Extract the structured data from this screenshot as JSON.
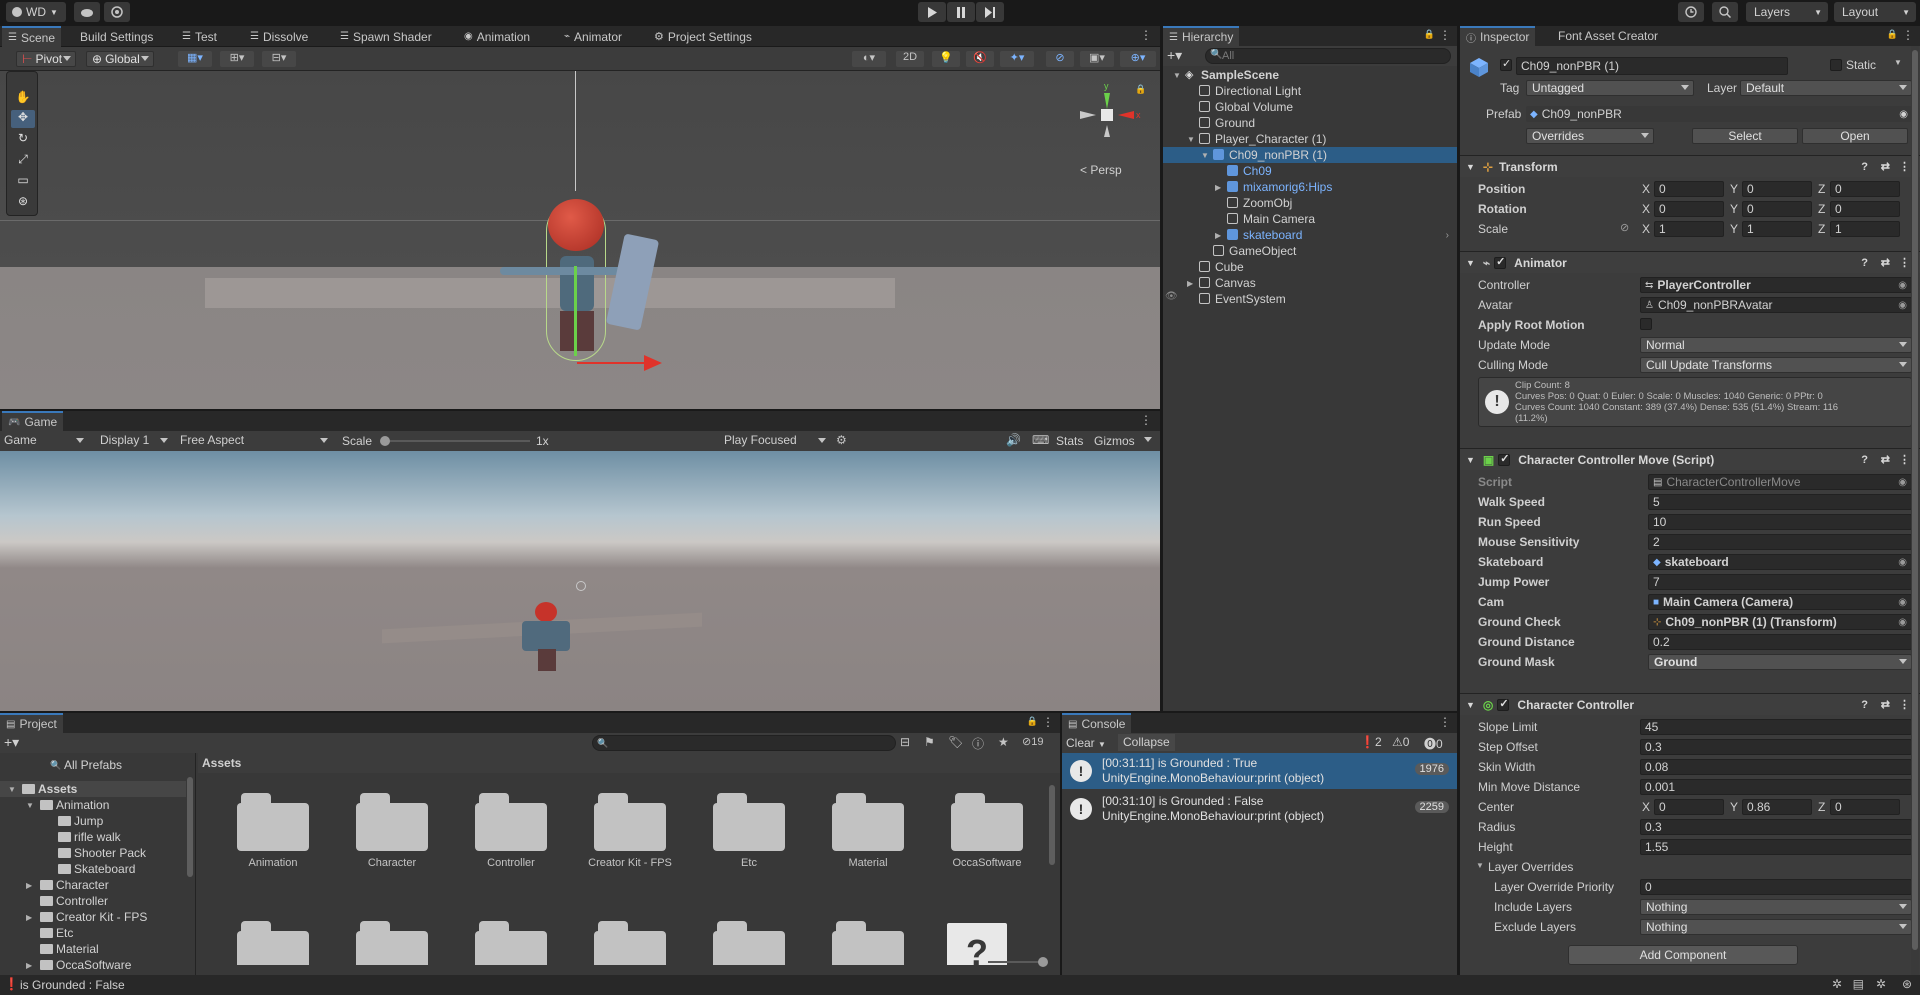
{
  "topbar": {
    "account": "WD",
    "layers": "Layers",
    "layout": "Layout"
  },
  "scene_tabs": [
    "Scene",
    "Build Settings",
    "Test",
    "Dissolve",
    "Spawn Shader",
    "Animation",
    "Animator",
    "Project Settings"
  ],
  "scene_toolbar": {
    "pivot": "Pivot",
    "global": "Global",
    "mode2d": "2D",
    "persp": "< Persp"
  },
  "game": {
    "tab": "Game",
    "display_mode": "Game",
    "display": "Display 1",
    "aspect": "Free Aspect",
    "scale_label": "Scale",
    "scale_value": "1x",
    "play_focused": "Play Focused",
    "stats": "Stats",
    "gizmos": "Gizmos"
  },
  "hierarchy": {
    "tab": "Hierarchy",
    "search_placeholder": "All",
    "items": [
      {
        "label": "SampleScene",
        "indent": 0,
        "kind": "scene",
        "arrow": "open"
      },
      {
        "label": "Directional Light",
        "indent": 1,
        "kind": "go"
      },
      {
        "label": "Global Volume",
        "indent": 1,
        "kind": "go"
      },
      {
        "label": "Ground",
        "indent": 1,
        "kind": "go"
      },
      {
        "label": "Player_Character (1)",
        "indent": 1,
        "kind": "go",
        "arrow": "open"
      },
      {
        "label": "Ch09_nonPBR (1)",
        "indent": 2,
        "kind": "prefab",
        "arrow": "open",
        "selected": true
      },
      {
        "label": "Ch09",
        "indent": 3,
        "kind": "prefab",
        "blue": true
      },
      {
        "label": "mixamorig6:Hips",
        "indent": 3,
        "kind": "prefab",
        "blue": true,
        "arrow": "closed"
      },
      {
        "label": "ZoomObj",
        "indent": 3,
        "kind": "go"
      },
      {
        "label": "Main Camera",
        "indent": 3,
        "kind": "go"
      },
      {
        "label": "skateboard",
        "indent": 3,
        "kind": "prefab",
        "blue": true,
        "arrow": "closed"
      },
      {
        "label": "GameObject",
        "indent": 2,
        "kind": "go"
      },
      {
        "label": "Cube",
        "indent": 1,
        "kind": "go"
      },
      {
        "label": "Canvas",
        "indent": 1,
        "kind": "go",
        "arrow": "closed"
      },
      {
        "label": "EventSystem",
        "indent": 1,
        "kind": "go"
      }
    ]
  },
  "inspector": {
    "tabs": [
      "Inspector",
      "Font Asset Creator"
    ],
    "object_name": "Ch09_nonPBR (1)",
    "static": "Static",
    "tag_label": "Tag",
    "tag": "Untagged",
    "layer_label": "Layer",
    "layer": "Default",
    "prefab_label": "Prefab",
    "prefab": "Ch09_nonPBR",
    "overrides": "Overrides",
    "select": "Select",
    "open": "Open",
    "transform": {
      "title": "Transform",
      "position_label": "Position",
      "position": [
        "0",
        "0",
        "0"
      ],
      "rotation_label": "Rotation",
      "rotation": [
        "0",
        "0",
        "0"
      ],
      "scale_label": "Scale",
      "scale": [
        "1",
        "1",
        "1"
      ]
    },
    "animator": {
      "title": "Animator",
      "controller_label": "Controller",
      "controller": "PlayerController",
      "avatar_label": "Avatar",
      "avatar": "Ch09_nonPBRAvatar",
      "root_motion_label": "Apply Root Motion",
      "update_mode_label": "Update Mode",
      "update_mode": "Normal",
      "culling_label": "Culling Mode",
      "culling": "Cull Update Transforms",
      "info_lines": [
        "Clip Count: 8",
        "Curves Pos: 0 Quat: 0 Euler: 0 Scale: 0 Muscles: 1040 Generic: 0 PPtr: 0",
        "Curves Count: 1040 Constant: 389 (37.4%) Dense: 535 (51.4%) Stream: 116",
        "(11.2%)"
      ]
    },
    "ccm": {
      "title": "Character Controller Move (Script)",
      "script_label": "Script",
      "script": "CharacterControllerMove",
      "walk_label": "Walk Speed",
      "walk": "5",
      "run_label": "Run Speed",
      "run": "10",
      "mouse_label": "Mouse Sensitivity",
      "mouse": "2",
      "skate_label": "Skateboard",
      "skate": "skateboard",
      "jump_label": "Jump Power",
      "jump": "7",
      "cam_label": "Cam",
      "cam": "Main Camera (Camera)",
      "gcheck_label": "Ground Check",
      "gcheck": "Ch09_nonPBR (1) (Transform)",
      "gdist_label": "Ground Distance",
      "gdist": "0.2",
      "gmask_label": "Ground Mask",
      "gmask": "Ground"
    },
    "cc": {
      "title": "Character Controller",
      "slope_label": "Slope Limit",
      "slope": "45",
      "step_label": "Step Offset",
      "step": "0.3",
      "skin_label": "Skin Width",
      "skin": "0.08",
      "minmove_label": "Min Move Distance",
      "minmove": "0.001",
      "center_label": "Center",
      "center": [
        "0",
        "0.86",
        "0"
      ],
      "radius_label": "Radius",
      "radius": "0.3",
      "height_label": "Height",
      "height": "1.55",
      "overrides_label": "Layer Overrides",
      "priority_label": "Layer Override Priority",
      "priority": "0",
      "include_label": "Include Layers",
      "include": "Nothing",
      "exclude_label": "Exclude Layers",
      "exclude": "Nothing"
    },
    "add_component": "Add Component"
  },
  "project": {
    "tab": "Project",
    "breadcrumb": "Assets",
    "hidden_count": "19",
    "tree": [
      {
        "label": "All Prefabs",
        "indent": 1,
        "kind": "search"
      },
      {
        "label": "Assets",
        "indent": 0,
        "kind": "folder",
        "arrow": "open",
        "bold": true
      },
      {
        "label": "Animation",
        "indent": 1,
        "kind": "folder",
        "arrow": "open"
      },
      {
        "label": "Jump",
        "indent": 2,
        "kind": "folder"
      },
      {
        "label": "rifle walk",
        "indent": 2,
        "kind": "folder"
      },
      {
        "label": "Shooter Pack",
        "indent": 2,
        "kind": "folder"
      },
      {
        "label": "Skateboard",
        "indent": 2,
        "kind": "folder"
      },
      {
        "label": "Character",
        "indent": 1,
        "kind": "folder",
        "arrow": "closed"
      },
      {
        "label": "Controller",
        "indent": 1,
        "kind": "folder"
      },
      {
        "label": "Creator Kit - FPS",
        "indent": 1,
        "kind": "folder",
        "arrow": "closed"
      },
      {
        "label": "Etc",
        "indent": 1,
        "kind": "folder"
      },
      {
        "label": "Material",
        "indent": 1,
        "kind": "folder"
      },
      {
        "label": "OccaSoftware",
        "indent": 1,
        "kind": "folder",
        "arrow": "closed"
      }
    ],
    "folders": [
      "Animation",
      "Character",
      "Controller",
      "Creator Kit - FPS",
      "Etc",
      "Material",
      "OccaSoftware"
    ]
  },
  "console": {
    "tab": "Console",
    "clear": "Clear",
    "collapse": "Collapse",
    "counts": [
      "2",
      "0",
      "0"
    ],
    "entries": [
      {
        "line1": "[00:31:11] is Grounded : True",
        "line2": "UnityEngine.MonoBehaviour:print (object)",
        "count": "1976",
        "selected": true
      },
      {
        "line1": "[00:31:10] is Grounded : False",
        "line2": "UnityEngine.MonoBehaviour:print (object)",
        "count": "2259",
        "selected": false
      }
    ]
  },
  "status": {
    "message": "is Grounded : False"
  },
  "colors": {
    "accent": "#3a79bb",
    "selection": "#2c5d87",
    "panel": "#383838"
  }
}
